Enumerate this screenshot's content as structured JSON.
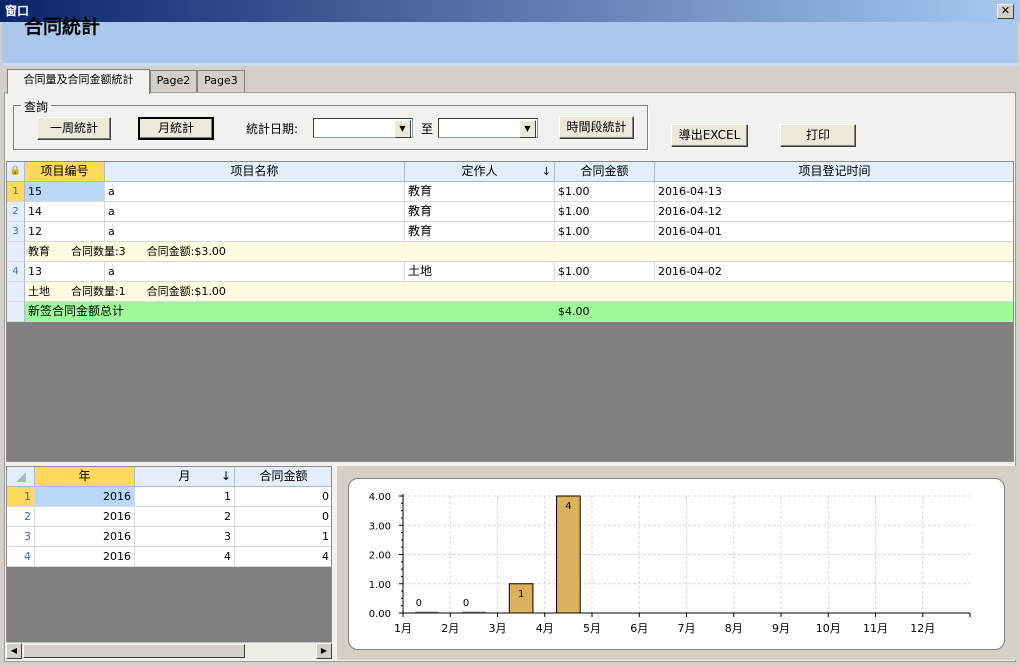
{
  "window": {
    "title": "窗口",
    "close_symbol": "✕"
  },
  "header": {
    "title": "合同統計"
  },
  "tabs": [
    {
      "label": "合同量及合同金额統計",
      "active": true
    },
    {
      "label": "Page2",
      "active": false
    },
    {
      "label": "Page3",
      "active": false
    }
  ],
  "query": {
    "legend": "查詢",
    "week_button": "一周統計",
    "month_button": "月統計",
    "date_label": "統計日期:",
    "to_label": "至",
    "range_button": "時間段統計"
  },
  "actions": {
    "export_button": "導出EXCEL",
    "print_button": "打印"
  },
  "main_grid": {
    "columns": [
      "项目编号",
      "项目名称",
      "定作人",
      "合同金额",
      "项目登记时间"
    ],
    "sort_indicator": "↓",
    "lock_icon": "🔒",
    "rows": [
      {
        "type": "data",
        "rownum": "1",
        "cells": [
          "15",
          "a",
          "教育",
          "$1.00",
          "2016-04-13"
        ]
      },
      {
        "type": "data",
        "rownum": "2",
        "cells": [
          "14",
          "a",
          "教育",
          "$1.00",
          "2016-04-12"
        ]
      },
      {
        "type": "data",
        "rownum": "3",
        "cells": [
          "12",
          "a",
          "教育",
          "$1.00",
          "2016-04-01"
        ]
      },
      {
        "type": "group",
        "text": "教育      合同数量:3      合同金额:$3.00"
      },
      {
        "type": "data",
        "rownum": "4",
        "cells": [
          "13",
          "a",
          "土地",
          "$1.00",
          "2016-04-02"
        ]
      },
      {
        "type": "group",
        "text": "土地      合同数量:1      合同金额:$1.00"
      },
      {
        "type": "total",
        "label": "新签合同金额总计",
        "amount": "$4.00"
      }
    ]
  },
  "summary_grid": {
    "columns": [
      "年",
      "月",
      "合同金额"
    ],
    "sort_indicator": "↓",
    "rows": [
      {
        "rownum": "1",
        "cells": [
          "2016",
          "1",
          "0"
        ]
      },
      {
        "rownum": "2",
        "cells": [
          "2016",
          "2",
          "0"
        ]
      },
      {
        "rownum": "3",
        "cells": [
          "2016",
          "3",
          "1"
        ]
      },
      {
        "rownum": "4",
        "cells": [
          "2016",
          "4",
          "4"
        ]
      }
    ]
  },
  "chart_data": {
    "type": "bar",
    "categories": [
      "1月",
      "2月",
      "3月",
      "4月",
      "5月",
      "6月",
      "7月",
      "8月",
      "9月",
      "10月",
      "11月",
      "12月"
    ],
    "values": [
      0,
      0,
      1,
      4,
      null,
      null,
      null,
      null,
      null,
      null,
      null,
      null
    ],
    "data_labels": [
      "0",
      "0",
      "1",
      "4"
    ],
    "yticks": [
      "0.00",
      "1.00",
      "2.00",
      "3.00",
      "4.00"
    ],
    "ylim": [
      0,
      4
    ],
    "grid": true,
    "bar_color": "#deb05c",
    "title": "",
    "xlabel": "",
    "ylabel": ""
  }
}
